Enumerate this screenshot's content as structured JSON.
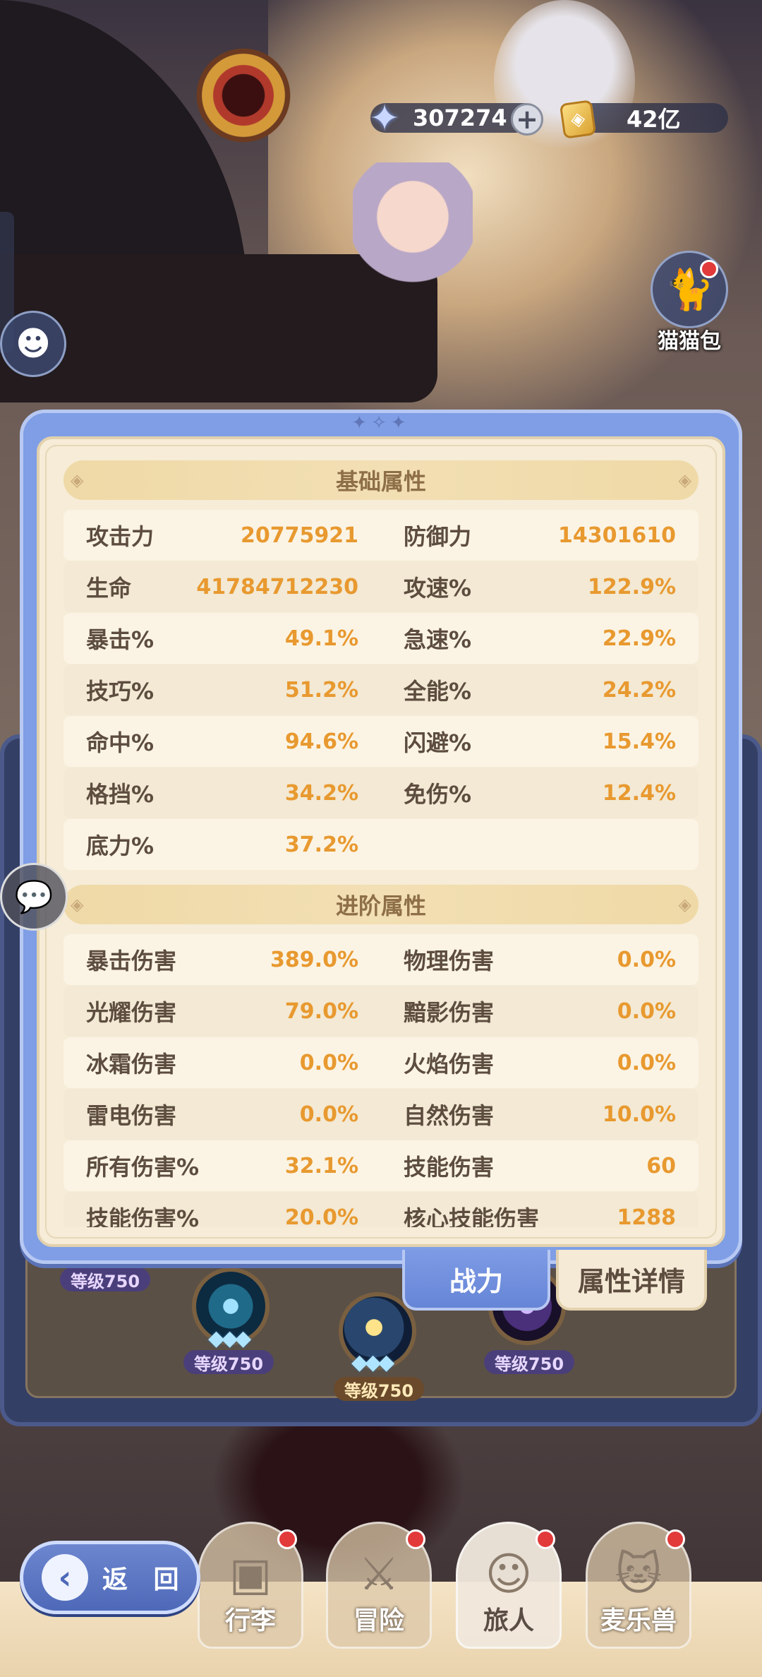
{
  "currency": {
    "gems": "307274",
    "gold": "42亿",
    "gold_symbol": "◈"
  },
  "side": {
    "cat_bag_label": "猫猫包"
  },
  "stats": {
    "basic_title": "基础属性",
    "basic": [
      {
        "l_name": "攻击力",
        "l_val": "20775921",
        "r_name": "防御力",
        "r_val": "14301610"
      },
      {
        "l_name": "生命",
        "l_val": "41784712230",
        "r_name": "攻速%",
        "r_val": "122.9%"
      },
      {
        "l_name": "暴击%",
        "l_val": "49.1%",
        "r_name": "急速%",
        "r_val": "22.9%"
      },
      {
        "l_name": "技巧%",
        "l_val": "51.2%",
        "r_name": "全能%",
        "r_val": "24.2%"
      },
      {
        "l_name": "命中%",
        "l_val": "94.6%",
        "r_name": "闪避%",
        "r_val": "15.4%"
      },
      {
        "l_name": "格挡%",
        "l_val": "34.2%",
        "r_name": "免伤%",
        "r_val": "12.4%"
      },
      {
        "l_name": "底力%",
        "l_val": "37.2%",
        "r_name": "",
        "r_val": ""
      }
    ],
    "advanced_title": "进阶属性",
    "advanced": [
      {
        "l_name": "暴击伤害",
        "l_val": "389.0%",
        "r_name": "物理伤害",
        "r_val": "0.0%"
      },
      {
        "l_name": "光耀伤害",
        "l_val": "79.0%",
        "r_name": "黯影伤害",
        "r_val": "0.0%"
      },
      {
        "l_name": "冰霜伤害",
        "l_val": "0.0%",
        "r_name": "火焰伤害",
        "r_val": "0.0%"
      },
      {
        "l_name": "雷电伤害",
        "l_val": "0.0%",
        "r_name": "自然伤害",
        "r_val": "10.0%"
      },
      {
        "l_name": "所有伤害%",
        "l_val": "32.1%",
        "r_name": "技能伤害",
        "r_val": "60"
      },
      {
        "l_name": "技能伤害%",
        "l_val": "20.0%",
        "r_name": "核心技能伤害",
        "r_val": "1288"
      }
    ]
  },
  "tabs": {
    "power": "战力",
    "detail": "属性详情"
  },
  "levels": {
    "tag": "等级750"
  },
  "back_label": "返 回",
  "nav": [
    {
      "label": "行李"
    },
    {
      "label": "冒险"
    },
    {
      "label": "旅人"
    },
    {
      "label": "麦乐兽"
    }
  ]
}
